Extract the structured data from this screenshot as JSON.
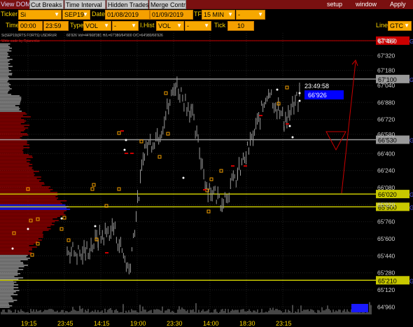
{
  "menubar": {
    "view_dom": "View DOM",
    "tabs": [
      "Cut Breaks",
      "Time Interval",
      "Hidden Trades",
      "Merge Contr"
    ],
    "right": [
      "setup",
      "window",
      "Apply"
    ]
  },
  "toolbar1": {
    "ticker_label": "Ticker",
    "ticker_value": "Si",
    "contract": "SEP19",
    "date_label": "Date",
    "date_from": "01/08/2019",
    "date_to": "01/09/2019",
    "tf_label": "TF",
    "tf_value": "15 MIN",
    "extra_value": "-"
  },
  "toolbar2": {
    "time_label": "Time",
    "time_from": "00:00",
    "time_to": "23:59",
    "type_label": "Type",
    "type_value": "VOL",
    "type_extra": "-",
    "ihist_label": "I.Hist",
    "ihist_value": "VOL",
    "ihist_extra": "-",
    "tick_label": "Tick",
    "tick_value": "10",
    "line_label": "Line",
    "line_value": "GTC"
  },
  "chart_header": {
    "symbol_info": "Si(SEP19)(RTS FORTS) USD/RUR",
    "bar_info": "66'926  Vol=44'668'381  H/L=67'380/64'900  O/C=64'980/66'926",
    "sub_info": "Write code by Rpanenko"
  },
  "clock": "23:49:58",
  "current_price": "66'926",
  "colors": {
    "menubar": "#7a1010",
    "toolbar_box": "#f5a000",
    "profile_red": "#8b0000",
    "profile_grey": "#8c8c8c",
    "poc_blue": "#1a1aff",
    "level_yellow": "#c8c800",
    "level_grey": "#9a9a9a",
    "current_price_box": "#0000ff"
  },
  "chart_data": {
    "type": "line",
    "title": "",
    "xlabel": "",
    "ylabel": "",
    "ylim": [
      64900,
      67500
    ],
    "y_ticks": [
      "67'460",
      "67'320",
      "67'180",
      "67'040",
      "66'880",
      "66'720",
      "66'580",
      "66'400",
      "66'240",
      "66'080",
      "65'920",
      "65'760",
      "65'600",
      "65'440",
      "65'280",
      "65'120",
      "64'960"
    ],
    "x_ticks": [
      "19:15",
      "23:45",
      "14:15",
      "19:00",
      "23:30",
      "14:00",
      "18:30",
      "23:15"
    ],
    "x": [
      "19:15",
      "21:30",
      "23:45",
      "09:00",
      "14:15",
      "16:30",
      "19:00",
      "21:15",
      "23:30",
      "11:45",
      "14:00",
      "16:15",
      "18:30",
      "20:45",
      "23:15",
      "23:45"
    ],
    "series": [
      {
        "values": [
          65500,
          65450,
          65600,
          65700,
          65300,
          66450,
          66600,
          67050,
          66800,
          66100,
          65950,
          66200,
          66550,
          67000,
          66700,
          66926
        ]
      }
    ],
    "levels": [
      {
        "price": 67460,
        "label": "67'460",
        "color": "#cc0000"
      },
      {
        "price": 67100,
        "label": "67'100",
        "color": "#9a9a9a"
      },
      {
        "price": 66530,
        "label": "66'530",
        "color": "#9a9a9a"
      },
      {
        "price": 66020,
        "label": "66'020",
        "color": "#c8c800"
      },
      {
        "price": 65900,
        "label": "65'900",
        "color": "#c8c800"
      },
      {
        "price": 65210,
        "label": "65'210",
        "color": "#c8c800"
      }
    ]
  }
}
